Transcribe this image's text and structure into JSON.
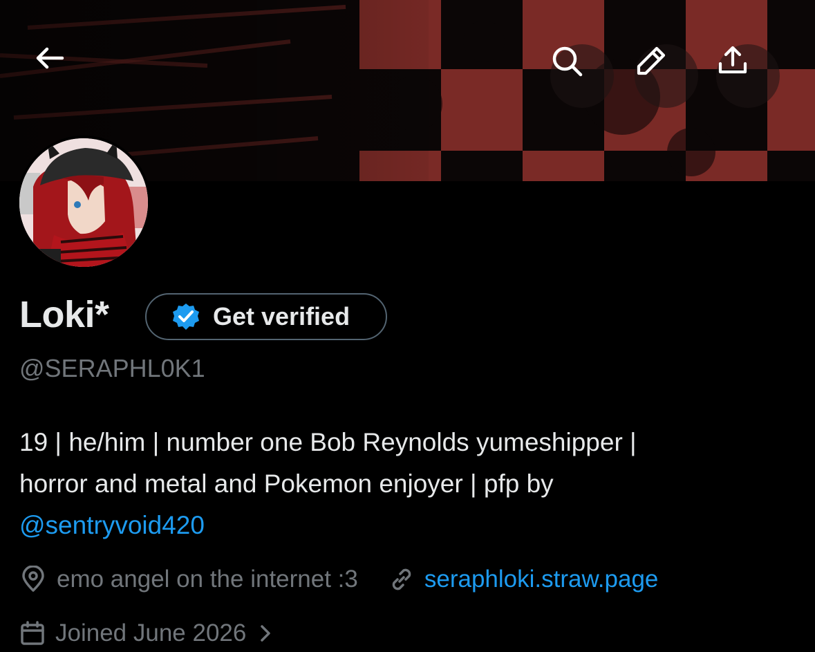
{
  "header": {
    "back_icon": "arrow-left-icon",
    "search_icon": "search-icon",
    "edit_icon": "pencil-icon",
    "share_icon": "share-icon",
    "banner_colors": {
      "dark": "#0b0606",
      "red": "#7a2a26"
    }
  },
  "profile": {
    "name": "Loki*",
    "verify_label": "Get verified",
    "handle": "@SERAPHL0K1",
    "bio_line1": "19 | he/him | number one Bob Reynolds yumeshipper |",
    "bio_line2": "horror and metal and Pokemon enjoyer | pfp by",
    "bio_mention": "@sentryvoid420",
    "location": "emo angel on the internet :3",
    "website": "seraphloki.straw.page",
    "joined": "Joined June 2026"
  },
  "colors": {
    "accent": "#1d9bf0",
    "muted": "#71767b",
    "text": "#e7e9ea",
    "background": "#000000"
  }
}
